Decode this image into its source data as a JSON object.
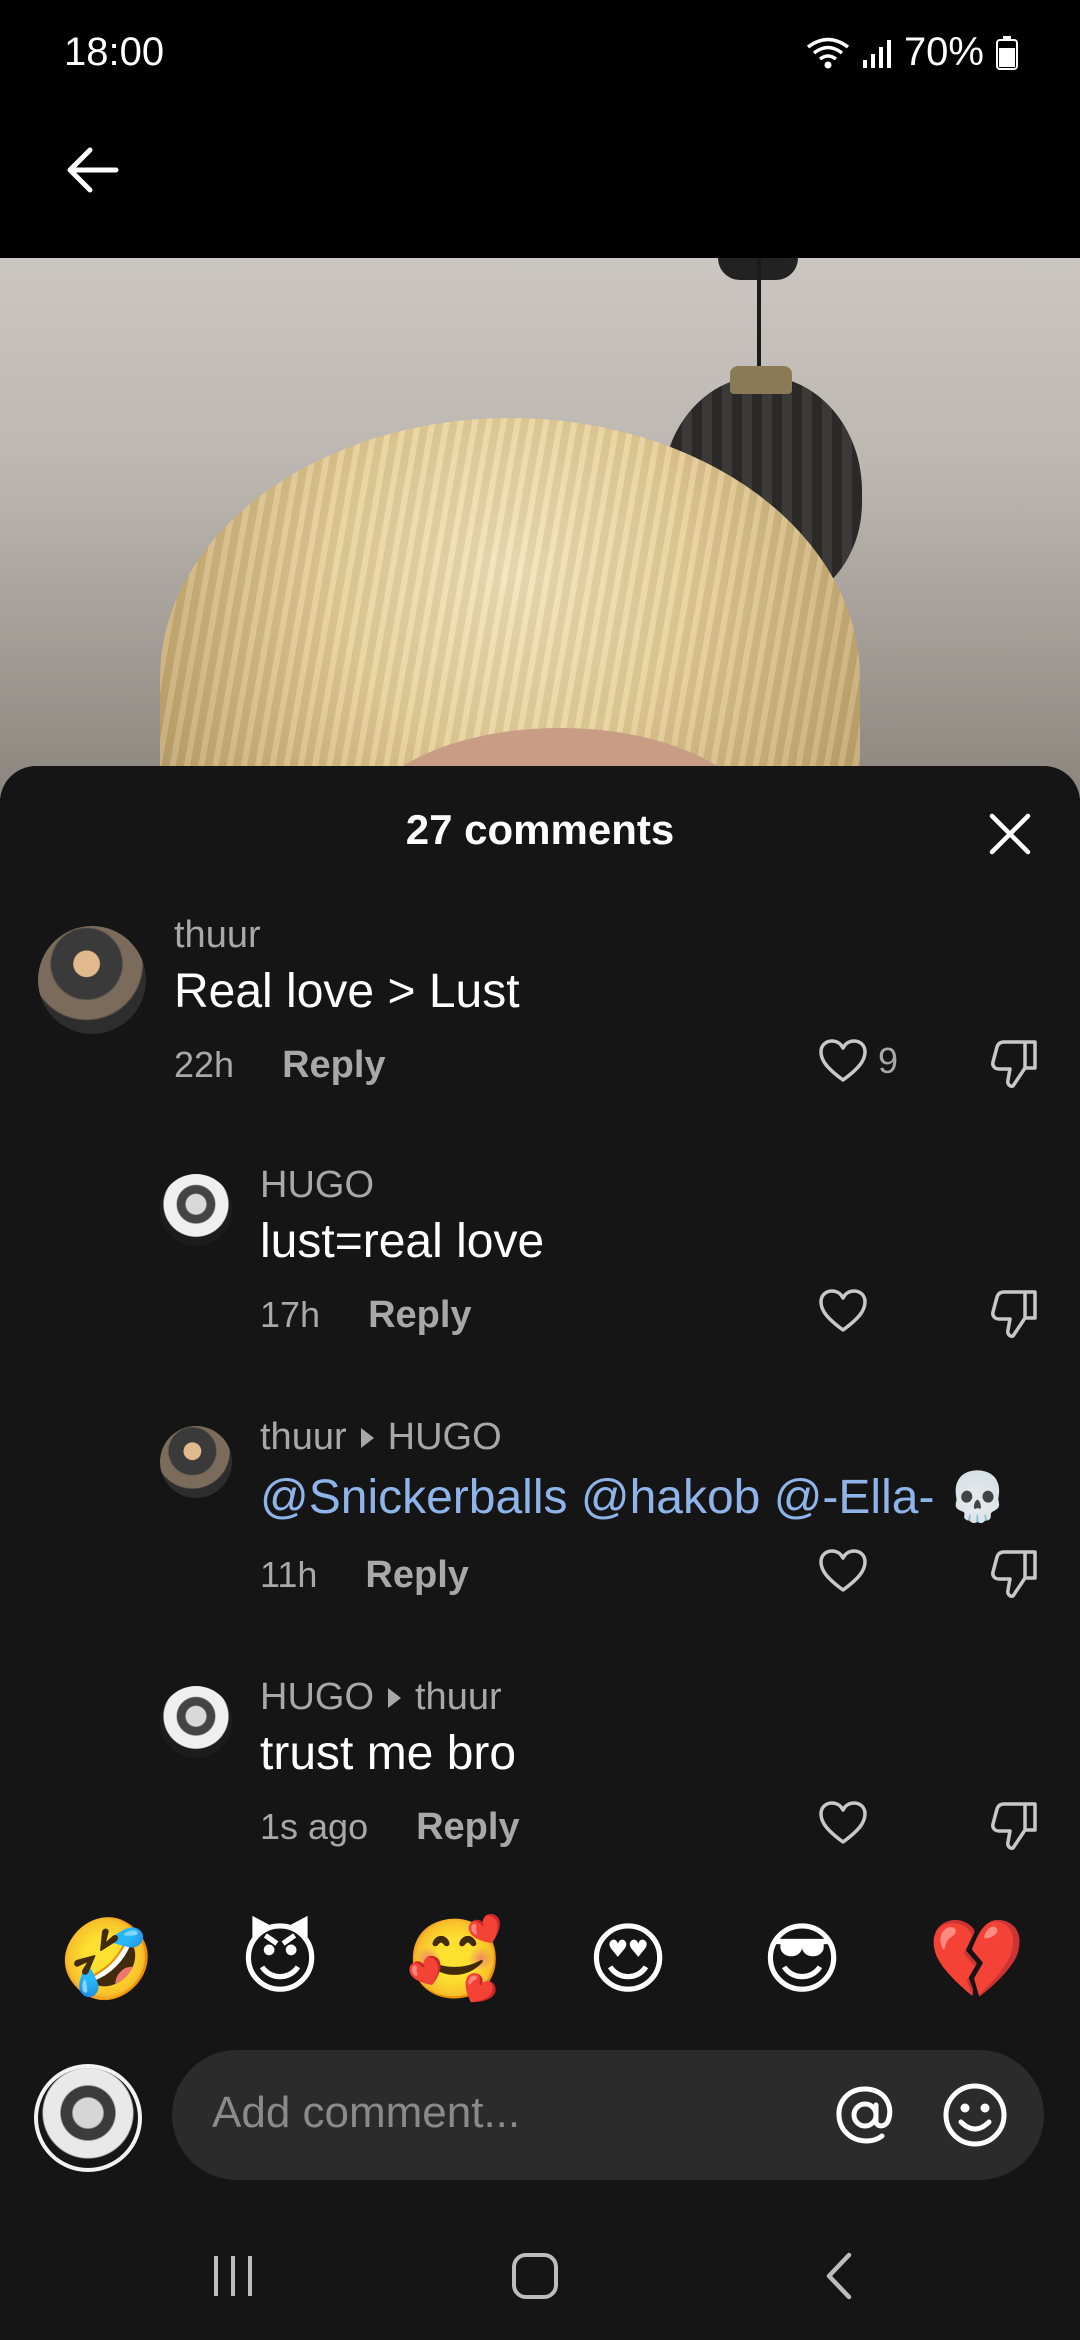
{
  "status": {
    "time": "18:00",
    "battery": "70%"
  },
  "sheet": {
    "title": "27 comments"
  },
  "comments": [
    {
      "user": "thuur",
      "text": "Real love > Lust",
      "time": "22h",
      "reply": "Reply",
      "likes": "9"
    },
    {
      "user": "HUGO",
      "text": "lust=real love",
      "time": "17h",
      "reply": "Reply"
    },
    {
      "user": "thuur",
      "reply_to": "HUGO",
      "mentions": [
        "@Snickerballs",
        "@hakob",
        "@-Ella-"
      ],
      "emoji": "💀",
      "time": "11h",
      "reply": "Reply"
    },
    {
      "user": "HUGO",
      "reply_to": "thuur",
      "text": "trust me bro",
      "time": "1s ago",
      "reply": "Reply"
    }
  ],
  "emojis": [
    "🤣",
    "😈",
    "🥰",
    "😍",
    "😎",
    "💔"
  ],
  "composer": {
    "placeholder": "Add comment..."
  }
}
